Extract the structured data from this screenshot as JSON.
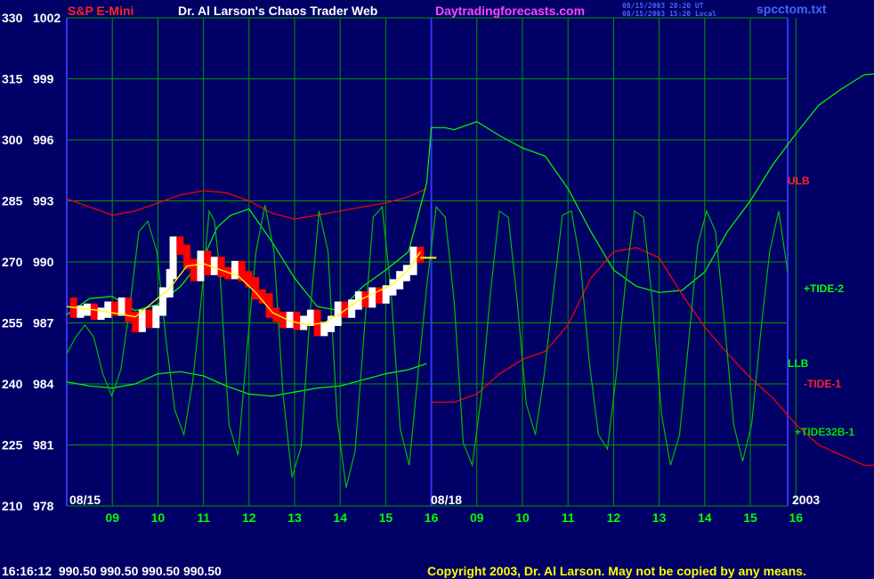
{
  "header": {
    "instrument": "S&P E-Mini",
    "title": "Dr. Al Larson's Chaos Trader Web",
    "site": "Daytradingforecasts.com",
    "stamp_ut": "08/15/2003 20:20 UT",
    "stamp_local": "08/15/2003 15:20 Local",
    "file": "spcctom.txt"
  },
  "footer": {
    "quote": "16:16:12  990.50 990.50 990.50 990.50",
    "copyright": "Copyright 2003, Dr. Al Larson. May not be copied by any means."
  },
  "colors": {
    "background": "#000066",
    "grid": "#009900",
    "axis_text": "#ffffff",
    "time_text": "#00ff00",
    "ulb": "#ff0000",
    "tide1": "#ff0000",
    "tide2": "#00ff00",
    "tide32b": "#00bb00",
    "llb": "#00ff00",
    "price_up": "#ffffff",
    "price_down": "#ff0000",
    "average": "#ffff00",
    "divider": "#3333ff",
    "site": "#ff44ff",
    "instrument": "#ff2222",
    "title": "#ffffff",
    "file": "#4466ff"
  },
  "chart_data": {
    "type": "line",
    "y_left_ticks": [
      330,
      315,
      300,
      285,
      270,
      255,
      240,
      225,
      210
    ],
    "y_right_ticks": [
      1002,
      999,
      996,
      993,
      990,
      987,
      984,
      981,
      978
    ],
    "ylim": [
      978,
      1002
    ],
    "x_hours": [
      8,
      9,
      10,
      11,
      12,
      13,
      14,
      15,
      16,
      16,
      9,
      10,
      11,
      12,
      13,
      14,
      15,
      16
    ],
    "x_hour_labels": [
      "09",
      "10",
      "11",
      "12",
      "13",
      "14",
      "15",
      "16",
      "09",
      "10",
      "11",
      "12",
      "13",
      "14",
      "15",
      "16"
    ],
    "date_labels": [
      "08/15",
      "08/18",
      "2003"
    ],
    "grid": true,
    "curve_labels": {
      "ulb": "ULB",
      "tide2": "+TIDE-2",
      "llb": "LLB",
      "tide1": "-TIDE-1",
      "tide32b": "+TIDE32B-1"
    },
    "series": {
      "ulb": [
        [
          0,
          993.1
        ],
        [
          0.5,
          992.7
        ],
        [
          1,
          992.3
        ],
        [
          1.5,
          992.5
        ],
        [
          2,
          992.9
        ],
        [
          2.5,
          993.3
        ],
        [
          3,
          993.5
        ],
        [
          3.5,
          993.4
        ],
        [
          4,
          993.0
        ],
        [
          4.5,
          992.4
        ],
        [
          5,
          992.1
        ],
        [
          5.5,
          992.3
        ],
        [
          6,
          992.5
        ],
        [
          6.5,
          992.7
        ],
        [
          7,
          992.9
        ],
        [
          7.5,
          993.2
        ],
        [
          7.9,
          993.6
        ]
      ],
      "llb": [
        [
          0,
          984.1
        ],
        [
          0.5,
          983.9
        ],
        [
          1,
          983.8
        ],
        [
          1.5,
          984.0
        ],
        [
          2,
          984.5
        ],
        [
          2.5,
          984.6
        ],
        [
          3,
          984.4
        ],
        [
          3.5,
          983.9
        ],
        [
          4,
          983.5
        ],
        [
          4.5,
          983.4
        ],
        [
          5,
          983.6
        ],
        [
          5.5,
          983.8
        ],
        [
          6,
          983.9
        ],
        [
          6.5,
          984.2
        ],
        [
          7,
          984.5
        ],
        [
          7.5,
          984.7
        ],
        [
          7.9,
          985.0
        ]
      ],
      "tide2": [
        [
          0,
          987.4
        ],
        [
          0.5,
          988.2
        ],
        [
          1,
          988.3
        ],
        [
          1.5,
          987.6
        ],
        [
          2,
          987.9
        ],
        [
          2.5,
          988.8
        ],
        [
          3,
          990.2
        ],
        [
          3.3,
          991.7
        ],
        [
          3.6,
          992.3
        ],
        [
          4,
          992.6
        ],
        [
          4.5,
          991.0
        ],
        [
          5,
          989.2
        ],
        [
          5.5,
          987.8
        ],
        [
          6,
          987.6
        ],
        [
          6.5,
          988.8
        ],
        [
          7,
          989.6
        ],
        [
          7.5,
          990.5
        ],
        [
          7.9,
          993.9
        ],
        [
          8.0,
          996.6
        ],
        [
          8.3,
          996.6
        ],
        [
          8.5,
          996.5
        ],
        [
          9,
          996.9
        ],
        [
          9.5,
          996.2
        ],
        [
          10,
          995.6
        ],
        [
          10.5,
          995.2
        ],
        [
          11,
          993.6
        ],
        [
          11.5,
          991.5
        ],
        [
          12,
          989.6
        ],
        [
          12.5,
          988.8
        ],
        [
          13,
          988.5
        ],
        [
          13.5,
          988.6
        ],
        [
          14,
          989.5
        ],
        [
          14.5,
          991.5
        ],
        [
          15,
          993.0
        ],
        [
          15.5,
          994.8
        ],
        [
          16,
          996.3
        ],
        [
          16.5,
          997.7
        ],
        [
          17,
          998.5
        ],
        [
          17.5,
          999.2
        ],
        [
          18,
          999.3
        ],
        [
          18.5,
          998.6
        ],
        [
          19,
          997.8
        ],
        [
          19.5,
          997.0
        ],
        [
          20,
          996.3
        ]
      ],
      "tide1": [
        [
          8.0,
          983.1
        ],
        [
          8.5,
          983.1
        ],
        [
          9,
          983.5
        ],
        [
          9.5,
          984.5
        ],
        [
          10,
          985.2
        ],
        [
          10.5,
          985.6
        ],
        [
          11,
          986.9
        ],
        [
          11.5,
          989.2
        ],
        [
          12,
          990.5
        ],
        [
          12.5,
          990.7
        ],
        [
          13,
          990.2
        ],
        [
          13.5,
          988.4
        ],
        [
          14,
          986.8
        ],
        [
          14.5,
          985.5
        ],
        [
          15,
          984.3
        ],
        [
          15.5,
          983.3
        ],
        [
          16,
          982.0
        ],
        [
          16.5,
          981.0
        ],
        [
          17,
          980.5
        ],
        [
          17.5,
          980.0
        ],
        [
          18,
          980.0
        ],
        [
          18.5,
          980.5
        ],
        [
          19,
          981.4
        ],
        [
          19.5,
          982.3
        ],
        [
          20,
          983.1
        ]
      ],
      "tide32b": [
        [
          0,
          985.5
        ],
        [
          0.5,
          986.3
        ],
        [
          1,
          986.9
        ],
        [
          1.5,
          986.3
        ],
        [
          2,
          984.5
        ],
        [
          2.5,
          983.4
        ],
        [
          3,
          984.7
        ],
        [
          3.5,
          987.8
        ],
        [
          4,
          991.5
        ],
        [
          4.5,
          992.0
        ],
        [
          5,
          990.5
        ],
        [
          5.5,
          986.2
        ],
        [
          6,
          982.7
        ],
        [
          6.5,
          981.5
        ],
        [
          7,
          984.2
        ],
        [
          7.5,
          988.5
        ],
        [
          7.9,
          992.5
        ],
        [
          8.2,
          992.0
        ],
        [
          8.5,
          989.5
        ],
        [
          9,
          982.0
        ],
        [
          9.5,
          980.5
        ],
        [
          10,
          985.7
        ],
        [
          10.5,
          990.5
        ],
        [
          11,
          992.8
        ],
        [
          11.5,
          990.5
        ],
        [
          12,
          983.5
        ],
        [
          12.5,
          979.4
        ],
        [
          13,
          980.9
        ],
        [
          13.5,
          987.5
        ],
        [
          14,
          992.5
        ],
        [
          14.5,
          990.5
        ],
        [
          15,
          982.3
        ],
        [
          15.5,
          978.9
        ],
        [
          16,
          980.7
        ],
        [
          16.5,
          986.5
        ],
        [
          17,
          992.2
        ],
        [
          17.5,
          992.7
        ],
        [
          18,
          988.5
        ],
        [
          18.5,
          981.8
        ],
        [
          19,
          980.0
        ],
        [
          19.5,
          984.6
        ],
        [
          20,
          989.0
        ],
        [
          20.5,
          992.7
        ],
        [
          21,
          992.2
        ],
        [
          21.5,
          988.0
        ],
        [
          22,
          981.1
        ],
        [
          22.5,
          980.0
        ],
        [
          23,
          983.4
        ],
        [
          23.5,
          988.4
        ],
        [
          24,
          992.5
        ],
        [
          24.5,
          992.2
        ],
        [
          25,
          988.0
        ],
        [
          25.5,
          983.0
        ],
        [
          26,
          981.5
        ],
        [
          26.5,
          984.5
        ],
        [
          27,
          988.5
        ],
        [
          27.5,
          992.3
        ],
        [
          28,
          992.5
        ],
        [
          28.5,
          990.0
        ],
        [
          29,
          985.0
        ],
        [
          29.5,
          981.5
        ],
        [
          30,
          980.8
        ],
        [
          30.5,
          984.5
        ],
        [
          31,
          989.0
        ],
        [
          31.5,
          992.5
        ],
        [
          32,
          992.2
        ],
        [
          32.5,
          988.0
        ],
        [
          33,
          982.5
        ],
        [
          33.5,
          980.0
        ],
        [
          34,
          981.5
        ],
        [
          34.5,
          986.0
        ],
        [
          35,
          990.8
        ],
        [
          35.5,
          992.5
        ],
        [
          36,
          991.5
        ],
        [
          36.5,
          987.0
        ],
        [
          37,
          982.0
        ],
        [
          37.5,
          980.2
        ],
        [
          38,
          982.0
        ],
        [
          38.5,
          986.5
        ],
        [
          39,
          990.5
        ],
        [
          39.5,
          992.5
        ],
        [
          40,
          989.5
        ]
      ],
      "price": [
        [
          0,
          988.0
        ],
        [
          0.2,
          987.5
        ],
        [
          0.4,
          987.6
        ],
        [
          0.6,
          987.7
        ],
        [
          0.8,
          987.4
        ],
        [
          1.0,
          987.5
        ],
        [
          1.2,
          987.8
        ],
        [
          1.4,
          987.6
        ],
        [
          1.6,
          988.0
        ],
        [
          1.8,
          987.3
        ],
        [
          2.0,
          986.8
        ],
        [
          2.2,
          987.4
        ],
        [
          2.4,
          987.0
        ],
        [
          2.6,
          987.6
        ],
        [
          2.8,
          988.5
        ],
        [
          3.0,
          989.4
        ],
        [
          3.1,
          991.0
        ],
        [
          3.3,
          990.6
        ],
        [
          3.5,
          989.9
        ],
        [
          3.7,
          989.3
        ],
        [
          3.9,
          990.3
        ],
        [
          4.1,
          989.6
        ],
        [
          4.3,
          990.0
        ],
        [
          4.5,
          989.5
        ],
        [
          4.7,
          989.4
        ],
        [
          4.9,
          989.8
        ],
        [
          5.1,
          989.3
        ],
        [
          5.3,
          989.0
        ],
        [
          5.5,
          988.4
        ],
        [
          5.7,
          988.2
        ],
        [
          5.9,
          987.5
        ],
        [
          6.1,
          987.3
        ],
        [
          6.3,
          987.0
        ],
        [
          6.5,
          987.3
        ],
        [
          6.7,
          986.9
        ],
        [
          6.9,
          987.1
        ],
        [
          7.1,
          987.4
        ],
        [
          7.3,
          986.6
        ],
        [
          7.5,
          986.8
        ],
        [
          7.7,
          987.1
        ],
        [
          7.9,
          987.8
        ],
        [
          8.1,
          987.5
        ],
        [
          8.3,
          987.9
        ],
        [
          8.5,
          988.3
        ],
        [
          8.7,
          988.0
        ],
        [
          8.9,
          988.5
        ],
        [
          9.1,
          988.2
        ],
        [
          9.3,
          988.6
        ],
        [
          9.5,
          988.9
        ],
        [
          9.7,
          989.3
        ],
        [
          9.9,
          989.6
        ],
        [
          10.1,
          990.5
        ],
        [
          10.3,
          990.2
        ]
      ],
      "average": [
        [
          0,
          987.8
        ],
        [
          1,
          987.6
        ],
        [
          2,
          987.3
        ],
        [
          3,
          988.7
        ],
        [
          3.5,
          989.8
        ],
        [
          4,
          989.9
        ],
        [
          4.5,
          989.6
        ],
        [
          5,
          989.3
        ],
        [
          5.5,
          988.5
        ],
        [
          6,
          987.5
        ],
        [
          6.5,
          987.1
        ],
        [
          7,
          986.9
        ],
        [
          7.5,
          987.0
        ],
        [
          8,
          987.5
        ],
        [
          8.5,
          988.1
        ],
        [
          9,
          988.5
        ],
        [
          9.5,
          988.9
        ],
        [
          10,
          989.7
        ],
        [
          10.3,
          990.5
        ]
      ]
    }
  }
}
